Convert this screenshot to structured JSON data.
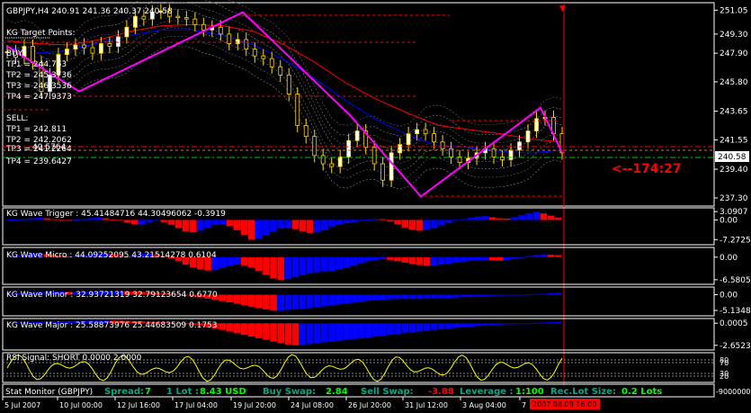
{
  "chart_data": [
    {
      "type": "line",
      "title": "GBPJPY,H4  240.91 241.36 240.37 240.58",
      "ylim": [
        236.9,
        251.4
      ],
      "yticks": [
        "251.05",
        "249.30",
        "247.90",
        "245.80",
        "243.65",
        "241.55",
        "239.40",
        "237.30"
      ],
      "last_price": "240.58",
      "countdown": "<--174:27",
      "grid": false,
      "series": [
        {
          "color": "#ffd700",
          "values": [
            248.0,
            247.6,
            248.4,
            247.2,
            245.1,
            246.3,
            247.8,
            248.2,
            248.5,
            248.3,
            247.9,
            248.6,
            248.4,
            249.1,
            249.8,
            250.6,
            250.4,
            250.9,
            251.0,
            250.6,
            250.5,
            250.4,
            250.0,
            249.6,
            249.8,
            249.3,
            248.6,
            248.9,
            248.2,
            247.7,
            247.5,
            246.9,
            246.3,
            244.9,
            242.6,
            241.8,
            240.4,
            239.8,
            239.6,
            240.3,
            241.5,
            242.2,
            241.0,
            239.8,
            238.6,
            240.6,
            241.2,
            242.0,
            242.3,
            242.0,
            241.4,
            240.9,
            240.3,
            239.9,
            240.2,
            240.6,
            240.9,
            240.3,
            240.1,
            240.8,
            241.4,
            242.2,
            243.1,
            243.2,
            242.0,
            240.6
          ]
        },
        {
          "color": "#ff00ff",
          "name": "zigzag",
          "values": [
            248.4,
            245.1,
            250.9,
            243.3,
            237.4,
            243.9,
            240.6
          ]
        },
        {
          "color": "#ff0000",
          "values": [
            248.8,
            248.6,
            248.5,
            248.9,
            249.5,
            249.9,
            250.0,
            249.9,
            249.5,
            248.5,
            247.2,
            245.7,
            244.5,
            243.5,
            242.6,
            242.3,
            242.0,
            241.6,
            241.4
          ]
        },
        {
          "color": "#0000ff",
          "values": [
            248.3,
            247.9,
            248.1,
            248.7,
            249.2,
            249.6,
            249.6,
            249.2,
            248.5,
            247.4,
            246.0,
            244.4,
            243.0,
            241.9,
            241.1,
            241.0,
            240.7,
            240.6,
            240.8
          ]
        }
      ],
      "annotations": {
        "header": "KG Target Points:",
        "buy_label": "BUY:",
        "buy_targets": [
          "TP1 = 244.763",
          "TP2 = 245.3736",
          "TP3 = 246.3536",
          "TP4 = 247.9373"
        ],
        "sell_label": "SELL:",
        "sell_targets": [
          "TP1 = 242.811",
          "TP2 = 242.2062",
          "TP3 = 241.2264",
          "TP4 = 239.6427"
        ],
        "overlap_label": "40.5764"
      },
      "date_labels": [
        "5 Jul 2007",
        "10 Jul 00:00",
        "12 Jul 16:00",
        "17 Jul 04:00",
        "19 Jul 20:00",
        "24 Jul 08:00",
        "26 Jul 20:00",
        "31 Jul 12:00",
        "3 Aug 04:00",
        "7"
      ],
      "date_highlight": "2007.08.09 16:00"
    },
    {
      "type": "bar",
      "title": "KG Wave Trigger : 45.41484716 44.30496062 -0.3919",
      "yticks": [
        "3.0907",
        "0.00",
        "-7.2725"
      ],
      "ylim": [
        -8.5,
        3.8
      ],
      "values": [
        0.1,
        0.2,
        0.4,
        0.6,
        0.8,
        0.6,
        0.3,
        -0.1,
        -0.3,
        0.1,
        0.4,
        0.7,
        0.9,
        0.6,
        0.2,
        -0.3,
        -1.0,
        -1.6,
        -1.5,
        -0.8,
        -0.3,
        -0.8,
        -1.8,
        -3.0,
        -4.2,
        -4.6,
        -4.0,
        -2.8,
        -1.8,
        -1.5,
        -2.2,
        -3.8,
        -5.5,
        -7.3,
        -6.8,
        -5.6,
        -4.2,
        -3.2,
        -3.0,
        -3.4,
        -4.2,
        -4.8,
        -4.6,
        -3.8,
        -2.6,
        -1.8,
        -1.2,
        -0.8,
        -0.4,
        0.1,
        0.4,
        0.3,
        -0.6,
        -1.6,
        -2.8,
        -3.6,
        -4.0,
        -3.6,
        -2.9,
        -2.0,
        -1.2,
        -0.4,
        0.3,
        0.8,
        1.2,
        1.4,
        1.0,
        0.6,
        0.5,
        1.0,
        1.8,
        2.4,
        3.0,
        2.4,
        1.6,
        0.8
      ],
      "colors_up": "#0000ff",
      "color_down": "#ff0000"
    },
    {
      "type": "bar",
      "title": "KG Wave Micro : 44.09252095 43.21514278 0.6104",
      "yticks": [
        "0.00",
        "-6.5805"
      ],
      "ylim": [
        -7.4,
        2.3
      ],
      "values": [
        0.3,
        0.6,
        0.8,
        1.0,
        1.1,
        0.9,
        0.7,
        0.4,
        0.2,
        0.3,
        0.6,
        0.9,
        1.1,
        1.2,
        0.9,
        0.4,
        0.2,
        0.6,
        1.0,
        1.1,
        0.8,
        0.3,
        -0.4,
        -1.2,
        -2.2,
        -3.0,
        -3.6,
        -3.9,
        -3.8,
        -3.2,
        -2.6,
        -2.2,
        -2.4,
        -3.0,
        -4.0,
        -5.2,
        -6.2,
        -6.6,
        -6.4,
        -5.9,
        -5.3,
        -4.8,
        -4.4,
        -4.2,
        -4.0,
        -3.6,
        -3.0,
        -2.4,
        -1.8,
        -1.2,
        -0.8,
        -0.6,
        -0.8,
        -1.2,
        -1.6,
        -2.0,
        -2.3,
        -2.5,
        -2.4,
        -2.2,
        -1.9,
        -1.6,
        -1.3,
        -1.0,
        -0.9,
        -0.8,
        -0.9,
        -1.0,
        -0.8,
        -0.5,
        -0.1,
        0.3,
        0.6,
        0.8,
        0.7,
        0.6
      ],
      "colors_up": "#0000ff",
      "color_down": "#ff0000"
    },
    {
      "type": "bar",
      "title": "KG Wave Minor : 32.93721319 32.79123654 0.6770",
      "yticks": [
        "0.00",
        "-5.1348"
      ],
      "ylim": [
        -6.3,
        1.9
      ],
      "values": [
        0.3,
        0.5,
        0.6,
        0.8,
        0.9,
        1.0,
        1.0,
        1.0,
        0.9,
        0.9,
        0.9,
        1.0,
        1.1,
        1.2,
        1.2,
        1.2,
        1.1,
        1.0,
        0.9,
        0.8,
        0.7,
        0.5,
        0.3,
        0.1,
        -0.2,
        -0.5,
        -0.9,
        -1.3,
        -1.7,
        -2.1,
        -2.5,
        -2.9,
        -3.4,
        -3.9,
        -4.4,
        -4.8,
        -5.1,
        -5.1,
        -5.0,
        -4.8,
        -4.6,
        -4.4,
        -4.1,
        -3.8,
        -3.5,
        -3.2,
        -2.9,
        -2.6,
        -2.3,
        -2.0,
        -1.8,
        -1.6,
        -1.5,
        -1.4,
        -1.4,
        -1.4,
        -1.4,
        -1.3,
        -1.2,
        -1.1,
        -1.0,
        -0.9,
        -0.8,
        -0.7,
        -0.6,
        -0.5,
        -0.4,
        -0.3,
        -0.2,
        -0.1,
        0.0,
        0.1,
        0.2,
        0.3,
        0.5,
        0.6
      ],
      "colors_up": "#0000ff",
      "color_down": "#ff0000"
    },
    {
      "type": "bar",
      "title": "KG Wave Major : 25.58873976 25.44683509 0.1753",
      "yticks": [
        "0.0005",
        "-2.6523"
      ],
      "ylim": [
        -3.0,
        0.35
      ],
      "values": [
        0.05,
        0.08,
        0.1,
        0.12,
        0.15,
        0.18,
        0.2,
        0.22,
        0.25,
        0.27,
        0.29,
        0.3,
        0.31,
        0.31,
        0.3,
        0.29,
        0.27,
        0.25,
        0.22,
        0.18,
        0.14,
        0.1,
        0.05,
        -0.02,
        -0.1,
        -0.2,
        -0.32,
        -0.46,
        -0.62,
        -0.8,
        -1.0,
        -1.2,
        -1.4,
        -1.6,
        -1.8,
        -2.0,
        -2.2,
        -2.4,
        -2.55,
        -2.65,
        -2.6,
        -2.5,
        -2.4,
        -2.3,
        -2.2,
        -2.1,
        -2.0,
        -1.9,
        -1.8,
        -1.7,
        -1.6,
        -1.5,
        -1.4,
        -1.3,
        -1.2,
        -1.1,
        -1.0,
        -0.9,
        -0.8,
        -0.72,
        -0.64,
        -0.56,
        -0.48,
        -0.4,
        -0.34,
        -0.28,
        -0.22,
        -0.16,
        -0.12,
        -0.08,
        -0.04,
        0.0,
        0.04,
        0.08,
        0.12,
        0.15
      ],
      "colors_up": "#0000ff",
      "color_down": "#ff0000"
    },
    {
      "type": "line",
      "title": "RSI Signal: SHORT 0.0000 2.0000",
      "yticks": [
        "80",
        "70",
        "30",
        "20"
      ],
      "color": "#ffff00"
    }
  ],
  "status_bar": {
    "label": "Stat Monitor (GBPJPY)",
    "spread_label": "Spread:",
    "spread_value": "7",
    "lot_label": "1 Lot :",
    "lot_value": "8.43 USD",
    "buy_swap_label": "Buy Swap:",
    "buy_swap_value": "2.84",
    "sell_swap_label": "Sell Swap:",
    "sell_swap_value": "-3.88",
    "leverage_label": "Leverage :",
    "leverage_value": "1:100",
    "rec_lot_label": "Rec.Lot Size:",
    "rec_lot_value": "0.2 Lots",
    "axis_value": "-9000000"
  },
  "colors": {
    "background": "#000000",
    "axis": "#ffffff",
    "bull": "#0000ff",
    "bear": "#ff0000",
    "price": "#ffd700",
    "zigzag": "#ff00ff",
    "green": "#00ff00",
    "yellow": "#ffff00"
  }
}
